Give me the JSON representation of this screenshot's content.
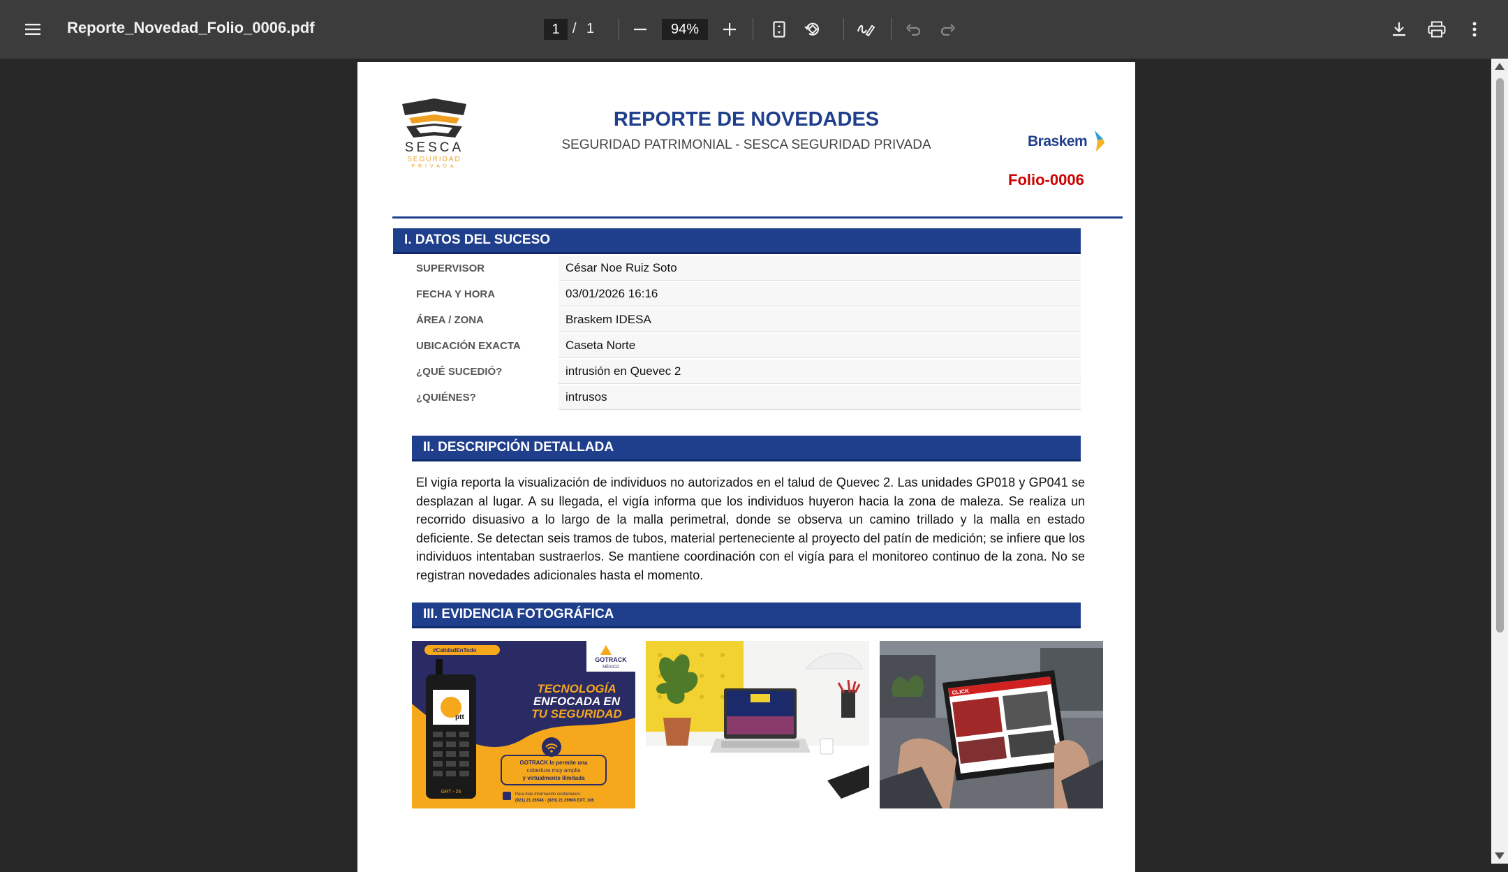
{
  "toolbar": {
    "file_name": "Reporte_Novedad_Folio_0006.pdf",
    "current_page": "1",
    "page_separator": "/",
    "total_pages": "1",
    "zoom": "94%"
  },
  "document": {
    "title": "REPORTE DE NOVEDADES",
    "subtitle": "SEGURIDAD PATRIMONIAL - SESCA SEGURIDAD PRIVADA",
    "folio": "Folio-0006",
    "logo_left": {
      "name": "SESCA",
      "sub": "SEGURIDAD",
      "sub2": "PRIVADA"
    },
    "logo_right": {
      "name": "Braskem"
    },
    "section1": {
      "heading": "I. DATOS DEL SUCESO",
      "fields": [
        {
          "label": "SUPERVISOR",
          "value": "César Noe Ruiz Soto"
        },
        {
          "label": "FECHA Y HORA",
          "value": "03/01/2026 16:16"
        },
        {
          "label": "ÁREA / ZONA",
          "value": "Braskem IDESA"
        },
        {
          "label": "UBICACIÓN EXACTA",
          "value": "Caseta Norte"
        },
        {
          "label": "¿QUÉ SUCEDIÓ?",
          "value": "intrusión en Quevec 2"
        },
        {
          "label": "¿QUIÉNES?",
          "value": "intrusos"
        }
      ]
    },
    "section2": {
      "heading": "II. DESCRIPCIÓN DETALLADA",
      "text": "El vigía reporta la visualización de individuos no autorizados en el talud de Quevec 2. Las unidades GP018 y GP041 se desplazan al lugar. A su llegada, el vigía informa que los individuos huyeron hacia la zona de maleza. Se realiza un recorrido disuasivo a lo largo de la malla perimetral, donde se observa un camino trillado y la malla en estado deficiente. Se detectan seis tramos de tubos, material perteneciente al proyecto del patín de medición; se infiere que los individuos intentaban sustraerlos. Se mantiene coordinación con el vigía para el monitoreo continuo de la zona. No se registran novedades adicionales hasta el momento."
    },
    "section3": {
      "heading": "III. EVIDENCIA FOTOGRÁFICA",
      "photo1": {
        "hashtag": "#CalidadEnTodo",
        "brand": "GOTRACK",
        "brand_sub": "MÉXICO",
        "headline1": "TECNOLOGÍA",
        "headline2": "ENFOCADA EN",
        "headline3": "TU SEGURIDAD",
        "phone_label": "ptt",
        "phone_model": "GRT - 25",
        "body1": "GOTRACK le permite una",
        "body2": "cobertura muy amplia",
        "body3": "y virtualmente ilimitada",
        "contact1": "Para más información contáctenos:",
        "contact2": "(921) 21 26548 · (920) 21 29908 EXT. 106"
      },
      "photo3": {
        "screen_label": "CLICK"
      }
    }
  }
}
